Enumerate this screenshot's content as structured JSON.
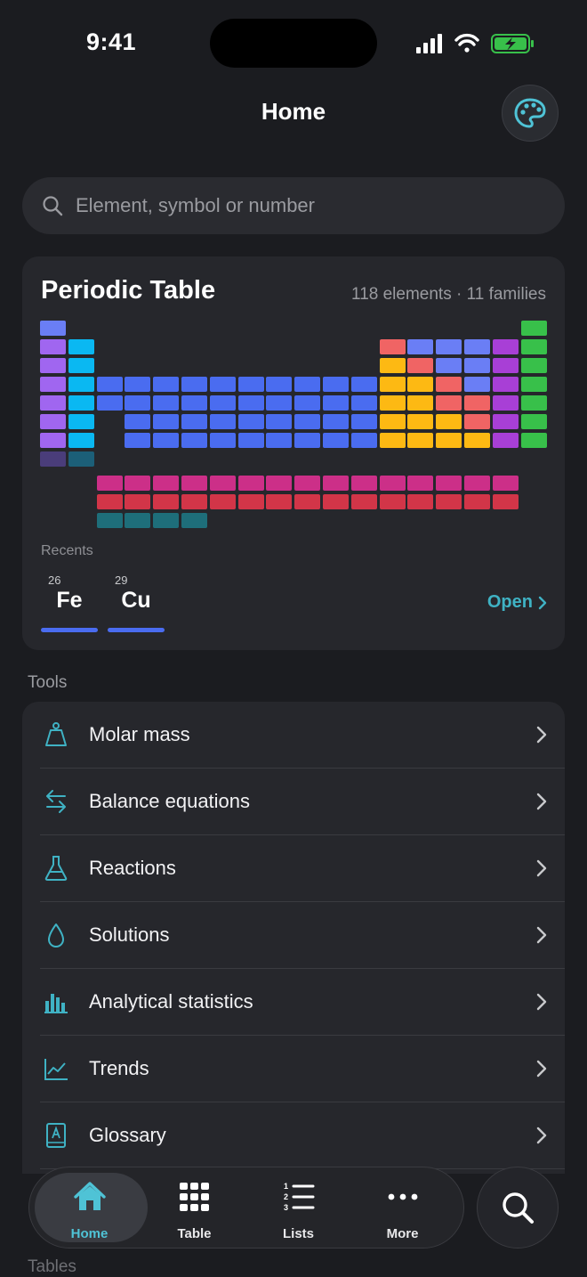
{
  "status": {
    "time": "9:41"
  },
  "nav": {
    "title": "Home"
  },
  "search": {
    "placeholder": "Element, symbol or number"
  },
  "card": {
    "title": "Periodic Table",
    "subtitle": "118 elements · 11 families",
    "recents_label": "Recents",
    "recents": [
      {
        "number": "26",
        "symbol": "Fe"
      },
      {
        "number": "29",
        "symbol": "Cu"
      }
    ],
    "open_label": "Open"
  },
  "colors": {
    "alkali": "#a066f0",
    "alkaline": "#0ab8f2",
    "transition": "#4a6cf0",
    "post_transition": "#fdb913",
    "metalloid": "#f06464",
    "nonmetal": "#6a7ef5",
    "halogen": "#a83fd6",
    "noble": "#38c04a",
    "lanthanide": "#cc2f88",
    "actinide": "#d23548",
    "unknown": "#1e6e7a",
    "accent": "#3fb2c4"
  },
  "tools": {
    "label": "Tools",
    "items": [
      {
        "label": "Molar mass",
        "icon": "weight-icon"
      },
      {
        "label": "Balance equations",
        "icon": "arrows-swap-icon"
      },
      {
        "label": "Reactions",
        "icon": "flask-icon"
      },
      {
        "label": "Solutions",
        "icon": "drop-icon"
      },
      {
        "label": "Analytical statistics",
        "icon": "bar-chart-icon"
      },
      {
        "label": "Trends",
        "icon": "line-chart-icon"
      },
      {
        "label": "Glossary",
        "icon": "book-icon"
      }
    ]
  },
  "tables_label": "Tables",
  "tabbar": {
    "tabs": [
      {
        "label": "Home",
        "icon": "house-icon"
      },
      {
        "label": "Table",
        "icon": "grid-icon"
      },
      {
        "label": "Lists",
        "icon": "list-icon"
      },
      {
        "label": "More",
        "icon": "ellipsis-icon"
      }
    ]
  }
}
